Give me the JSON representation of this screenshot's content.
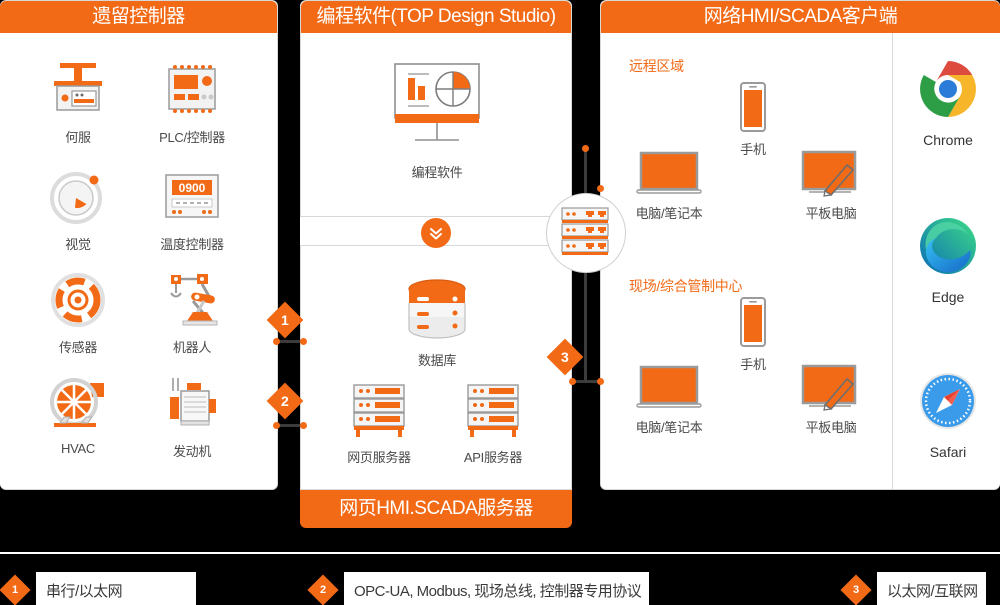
{
  "panels": {
    "legacy": {
      "title": "遗留控制器",
      "items": [
        {
          "label": "何服",
          "icon": "servo-icon"
        },
        {
          "label": "PLC/控制器",
          "icon": "plc-controller-icon"
        },
        {
          "label": "视觉",
          "icon": "vision-icon"
        },
        {
          "label": "温度控制器",
          "icon": "temperature-controller-icon",
          "display": "0900"
        },
        {
          "label": "传感器",
          "icon": "sensor-icon"
        },
        {
          "label": "机器人",
          "icon": "robot-icon"
        },
        {
          "label": "HVAC",
          "icon": "hvac-fan-icon"
        },
        {
          "label": "发动机",
          "icon": "motor-icon"
        }
      ]
    },
    "middle": {
      "title": "编程软件(TOP Design Studio)",
      "footer": "网页HMI.SCADA服务器",
      "software": {
        "label": "编程软件",
        "icon": "monitor-chart-icon"
      },
      "chevron_icon": "chevron-double-down-icon",
      "servers": [
        {
          "label": "数据库",
          "icon": "database-icon"
        },
        {
          "label": "网页服务器",
          "icon": "server-rack-icon"
        },
        {
          "label": "API服务器",
          "icon": "server-rack-icon"
        }
      ]
    },
    "clients": {
      "title": "网络HMI/SCADA客户端",
      "zones": [
        {
          "title": "远程区域",
          "devices": [
            {
              "label": "电脑/笔记本",
              "icon": "laptop-icon"
            },
            {
              "label": "手机",
              "icon": "smartphone-icon"
            },
            {
              "label": "平板电脑",
              "icon": "tablet-stylus-icon"
            }
          ]
        },
        {
          "title": "现场/综合管制中心",
          "devices": [
            {
              "label": "电脑/笔记本",
              "icon": "laptop-icon"
            },
            {
              "label": "手机",
              "icon": "smartphone-icon"
            },
            {
              "label": "平板电脑",
              "icon": "tablet-stylus-icon"
            }
          ]
        }
      ],
      "browsers": [
        {
          "name": "Chrome",
          "icon": "chrome-icon"
        },
        {
          "name": "Edge",
          "icon": "edge-icon"
        },
        {
          "name": "Safari",
          "icon": "safari-icon"
        }
      ]
    }
  },
  "switch": {
    "icon": "network-switch-icon"
  },
  "connector_badges": [
    {
      "number": "1"
    },
    {
      "number": "2"
    },
    {
      "number": "3"
    }
  ],
  "legend": [
    {
      "number": "1",
      "text": "串行/以太网"
    },
    {
      "number": "2",
      "text": "OPC-UA, Modbus, 现场总线, 控制器专用协议"
    },
    {
      "number": "3",
      "text": "以太网/互联网"
    }
  ],
  "colors": {
    "accent": "#f26a16",
    "background": "#000000",
    "panel": "#ffffff",
    "label": "#4a4a4a",
    "line": "#3c3c3c"
  }
}
